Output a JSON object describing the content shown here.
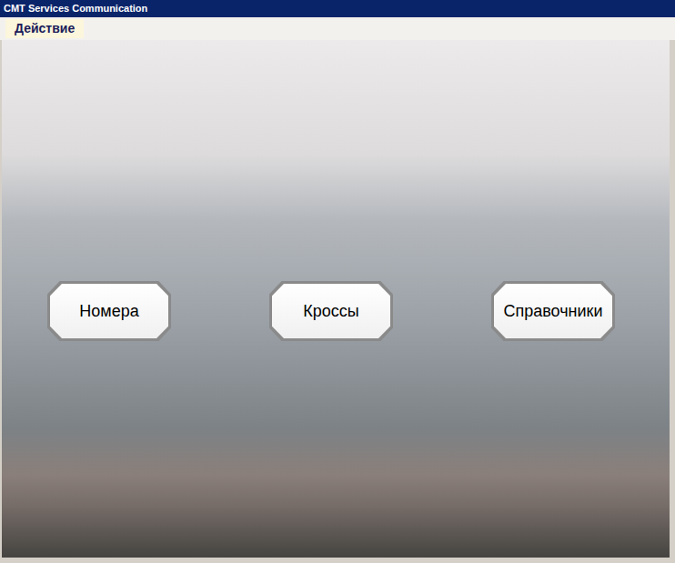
{
  "window": {
    "title": "CMT Services Communication"
  },
  "menu": [
    {
      "label": "Действие",
      "selected": true
    }
  ],
  "buttons": [
    {
      "label": "Номера"
    },
    {
      "label": "Кроссы"
    },
    {
      "label": "Справочники"
    }
  ]
}
